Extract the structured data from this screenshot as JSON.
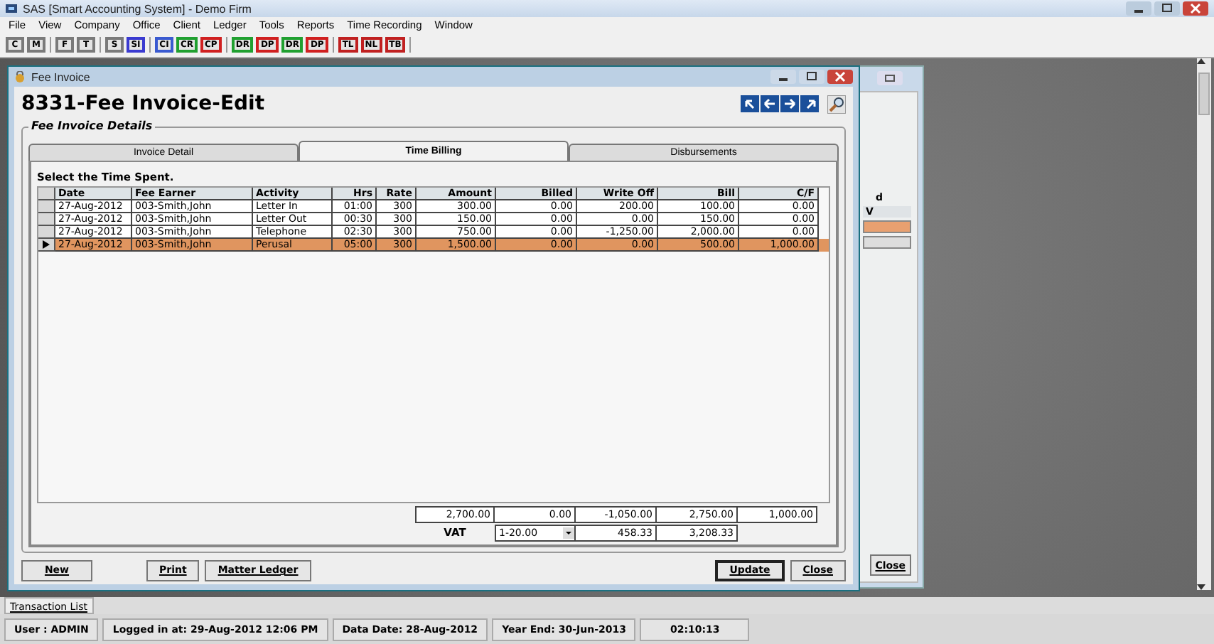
{
  "app_title": "SAS [Smart Accounting System] - Demo Firm",
  "menu": [
    "File",
    "View",
    "Company",
    "Office",
    "Client",
    "Ledger",
    "Tools",
    "Reports",
    "Time Recording",
    "Window"
  ],
  "toolbar": [
    [
      {
        "label": "C",
        "color": "#7a7a7a"
      },
      {
        "label": "M",
        "color": "#7a7a7a"
      }
    ],
    [
      {
        "label": "F",
        "color": "#7a7a7a"
      },
      {
        "label": "T",
        "color": "#7a7a7a"
      }
    ],
    [
      {
        "label": "S",
        "color": "#7a7a7a"
      },
      {
        "label": "SI",
        "color": "#3a3ad0"
      }
    ],
    [
      {
        "label": "CI",
        "color": "#3a5ad0"
      },
      {
        "label": "CR",
        "color": "#20a030"
      },
      {
        "label": "CP",
        "color": "#d02020"
      }
    ],
    [
      {
        "label": "DR",
        "color": "#20a030"
      },
      {
        "label": "DP",
        "color": "#d02020"
      },
      {
        "label": "DR",
        "color": "#20a030"
      },
      {
        "label": "DP",
        "color": "#d02020"
      }
    ],
    [
      {
        "label": "TL",
        "color": "#c02020"
      },
      {
        "label": "NL",
        "color": "#c02020"
      },
      {
        "label": "TB",
        "color": "#c02020"
      }
    ]
  ],
  "fee_window": {
    "title": "Fee Invoice",
    "heading": "8331-Fee Invoice-Edit",
    "group_title": "Fee Invoice Details",
    "tabs": [
      {
        "label": "Invoice Detail",
        "selected": false
      },
      {
        "label": "Time Billing",
        "selected": true
      },
      {
        "label": "Disbursements",
        "selected": false
      }
    ],
    "prompt": "Select the Time Spent.",
    "table": {
      "columns": [
        "Date",
        "Fee Earner",
        "Activity",
        "Hrs",
        "Rate",
        "Amount",
        "Billed",
        "Write Off",
        "Bill",
        "C/F"
      ],
      "rows": [
        {
          "selected": false,
          "cells": [
            "27-Aug-2012",
            "003-Smith,John",
            "Letter In",
            "01:00",
            "300",
            "300.00",
            "0.00",
            "200.00",
            "100.00",
            "0.00"
          ]
        },
        {
          "selected": false,
          "cells": [
            "27-Aug-2012",
            "003-Smith,John",
            "Letter Out",
            "00:30",
            "300",
            "150.00",
            "0.00",
            "0.00",
            "150.00",
            "0.00"
          ]
        },
        {
          "selected": false,
          "cells": [
            "27-Aug-2012",
            "003-Smith,John",
            "Telephone",
            "02:30",
            "300",
            "750.00",
            "0.00",
            "-1,250.00",
            "2,000.00",
            "0.00"
          ]
        },
        {
          "selected": true,
          "cells": [
            "27-Aug-2012",
            "003-Smith,John",
            "Perusal",
            "05:00",
            "300",
            "1,500.00",
            "0.00",
            "0.00",
            "500.00",
            "1,000.00"
          ]
        }
      ]
    },
    "totals": [
      "2,700.00",
      "0.00",
      "-1,050.00",
      "2,750.00",
      "1,000.00"
    ],
    "vat": {
      "label": "VAT",
      "rate": "1-20.00",
      "values": [
        "458.33",
        "3,208.33"
      ]
    },
    "buttons_left": [
      {
        "label": "New",
        "default": false
      },
      {
        "label": "Print",
        "default": false
      },
      {
        "label": "Matter Ledger",
        "default": false
      }
    ],
    "buttons_right": [
      {
        "label": "Update",
        "default": true
      },
      {
        "label": "Close",
        "default": false
      }
    ]
  },
  "background_window": {
    "label_fragment": "d",
    "column_fragment": "V",
    "button": "Close"
  },
  "transaction_tab": "Transaction List",
  "status_bar": [
    "User : ADMIN",
    "Logged in at: 29-Aug-2012 12:06 PM",
    "Data Date: 28-Aug-2012",
    "Year End: 30-Jun-2013",
    "02:10:13"
  ]
}
